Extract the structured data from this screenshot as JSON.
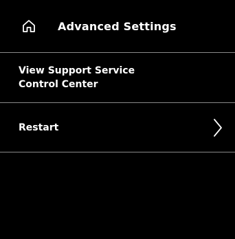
{
  "header": {
    "title": "Advanced Settings",
    "home_icon": "home-icon"
  },
  "menu": {
    "items": [
      {
        "label": "View Support Service Control Center",
        "icon": null
      },
      {
        "label": "Restart",
        "icon": "chevron-right-icon"
      }
    ]
  },
  "colors": {
    "background": "#000000",
    "text": "#ffffff",
    "divider": "#8a8a8a"
  }
}
